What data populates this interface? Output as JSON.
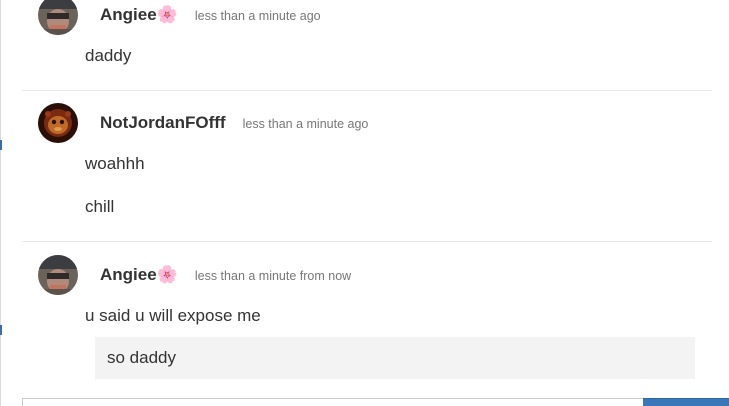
{
  "messages": [
    {
      "author": "Angiee🌸",
      "time": "less than a minute ago",
      "lines": [
        "daddy"
      ]
    },
    {
      "author": "NotJordanFOfff",
      "time": "less than a minute ago",
      "lines": [
        "woahhh",
        "chill"
      ]
    },
    {
      "author": "Angiee🌸",
      "time": "less than a minute from now",
      "lines": [
        "u said u will expose me",
        "so daddy"
      ]
    }
  ]
}
